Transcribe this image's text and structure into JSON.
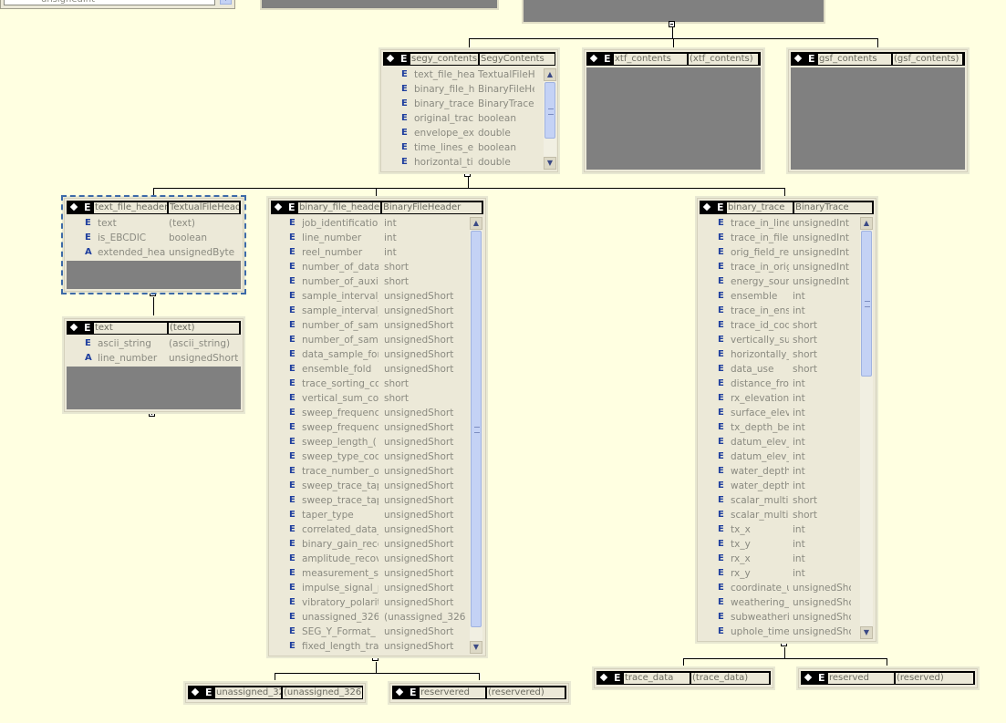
{
  "fragment_top_left": {
    "label": "unsignedInt"
  },
  "segy_contents": {
    "name": "segy_contents",
    "type": "SegyContents",
    "rows": [
      {
        "k": "E",
        "n": "text_file_hea",
        "t": "TextualFileH"
      },
      {
        "k": "E",
        "n": "binary_file_h",
        "t": "BinaryFileHe"
      },
      {
        "k": "E",
        "n": "binary_trace",
        "t": "BinaryTrace"
      },
      {
        "k": "E",
        "n": "original_trac",
        "t": "boolean"
      },
      {
        "k": "E",
        "n": "envelope_ex",
        "t": "double"
      },
      {
        "k": "E",
        "n": "time_lines_e",
        "t": "boolean"
      },
      {
        "k": "E",
        "n": "horizontal_ti",
        "t": "double"
      }
    ]
  },
  "xtf_contents": {
    "name": "xtf_contents",
    "type": "(xtf_contents)"
  },
  "gsf_contents": {
    "name": "gsf_contents",
    "type": "(gsf_contents)"
  },
  "text_file_header": {
    "name": "text_file_header",
    "type": "TextualFileHeader",
    "rows": [
      {
        "k": "E",
        "n": "text",
        "t": "(text)"
      },
      {
        "k": "E",
        "n": "is_EBCDIC",
        "t": "boolean"
      },
      {
        "k": "A",
        "n": "extended_hea",
        "t": "unsignedByte"
      }
    ]
  },
  "text": {
    "name": "text",
    "type": "(text)",
    "rows": [
      {
        "k": "E",
        "n": "ascii_string",
        "t": "(ascii_string)"
      },
      {
        "k": "A",
        "n": "line_number",
        "t": "unsignedShort"
      }
    ]
  },
  "binary_file_header": {
    "name": "binary_file_header",
    "type": "BinaryFileHeader",
    "rows": [
      {
        "k": "E",
        "n": "job_identification",
        "t": "int"
      },
      {
        "k": "E",
        "n": "line_number",
        "t": "int"
      },
      {
        "k": "E",
        "n": "reel_number",
        "t": "int"
      },
      {
        "k": "E",
        "n": "number_of_data",
        "t": "short"
      },
      {
        "k": "E",
        "n": "number_of_auxili",
        "t": "short"
      },
      {
        "k": "E",
        "n": "sample_interval_i",
        "t": "unsignedShort"
      },
      {
        "k": "E",
        "n": "sample_interval_i",
        "t": "unsignedShort"
      },
      {
        "k": "E",
        "n": "number_of_sam",
        "t": "unsignedShort"
      },
      {
        "k": "E",
        "n": "number_of_sam",
        "t": "unsignedShort"
      },
      {
        "k": "E",
        "n": "data_sample_for",
        "t": "unsignedShort"
      },
      {
        "k": "E",
        "n": "ensemble_fold",
        "t": "unsignedShort"
      },
      {
        "k": "E",
        "n": "trace_sorting_co",
        "t": "short"
      },
      {
        "k": "E",
        "n": "vertical_sum_cod",
        "t": "short"
      },
      {
        "k": "E",
        "n": "sweep_frequency",
        "t": "unsignedShort"
      },
      {
        "k": "E",
        "n": "sweep_frequency",
        "t": "unsignedShort"
      },
      {
        "k": "E",
        "n": "sweep_length_(",
        "t": "unsignedShort"
      },
      {
        "k": "E",
        "n": "sweep_type_cod",
        "t": "unsignedShort"
      },
      {
        "k": "E",
        "n": "trace_number_of",
        "t": "unsignedShort"
      },
      {
        "k": "E",
        "n": "sweep_trace_tap",
        "t": "unsignedShort"
      },
      {
        "k": "E",
        "n": "sweep_trace_tap",
        "t": "unsignedShort"
      },
      {
        "k": "E",
        "n": "taper_type",
        "t": "unsignedShort"
      },
      {
        "k": "E",
        "n": "correlated_data_",
        "t": "unsignedShort"
      },
      {
        "k": "E",
        "n": "binary_gain_reco",
        "t": "unsignedShort"
      },
      {
        "k": "E",
        "n": "amplitude_recov",
        "t": "unsignedShort"
      },
      {
        "k": "E",
        "n": "measurement_sy",
        "t": "unsignedShort"
      },
      {
        "k": "E",
        "n": "impulse_signal_p",
        "t": "unsignedShort"
      },
      {
        "k": "E",
        "n": "vibratory_polarit",
        "t": "unsignedShort"
      },
      {
        "k": "E",
        "n": "unassigned_3261",
        "t": "(unassigned_326"
      },
      {
        "k": "E",
        "n": "SEG_Y_Format_",
        "t": "unsignedShort"
      },
      {
        "k": "E",
        "n": "fixed_length_trac",
        "t": "unsignedShort"
      }
    ]
  },
  "binary_trace": {
    "name": "binary_trace",
    "type": "BinaryTrace",
    "rows": [
      {
        "k": "E",
        "n": "trace_in_line",
        "t": "unsignedInt"
      },
      {
        "k": "E",
        "n": "trace_in_file",
        "t": "unsignedInt"
      },
      {
        "k": "E",
        "n": "orig_field_re",
        "t": "unsignedInt"
      },
      {
        "k": "E",
        "n": "trace_in_orig",
        "t": "unsignedInt"
      },
      {
        "k": "E",
        "n": "energy_sour",
        "t": "unsignedInt"
      },
      {
        "k": "E",
        "n": "ensemble",
        "t": "int"
      },
      {
        "k": "E",
        "n": "trace_in_ens",
        "t": "int"
      },
      {
        "k": "E",
        "n": "trace_id_cod",
        "t": "short"
      },
      {
        "k": "E",
        "n": "vertically_su",
        "t": "short"
      },
      {
        "k": "E",
        "n": "horizontally_",
        "t": "short"
      },
      {
        "k": "E",
        "n": "data_use",
        "t": "short"
      },
      {
        "k": "E",
        "n": "distance_fro",
        "t": "int"
      },
      {
        "k": "E",
        "n": "rx_elevation",
        "t": "int"
      },
      {
        "k": "E",
        "n": "surface_elev",
        "t": "int"
      },
      {
        "k": "E",
        "n": "tx_depth_bel",
        "t": "int"
      },
      {
        "k": "E",
        "n": "datum_elev_",
        "t": "int"
      },
      {
        "k": "E",
        "n": "datum_elev_",
        "t": "int"
      },
      {
        "k": "E",
        "n": "water_depth",
        "t": "int"
      },
      {
        "k": "E",
        "n": "water_depth",
        "t": "int"
      },
      {
        "k": "E",
        "n": "scalar_multip",
        "t": "short"
      },
      {
        "k": "E",
        "n": "scalar_multip",
        "t": "short"
      },
      {
        "k": "E",
        "n": "tx_x",
        "t": "int"
      },
      {
        "k": "E",
        "n": "tx_y",
        "t": "int"
      },
      {
        "k": "E",
        "n": "rx_x",
        "t": "int"
      },
      {
        "k": "E",
        "n": "rx_y",
        "t": "int"
      },
      {
        "k": "E",
        "n": "coordinate_u",
        "t": "unsignedSho"
      },
      {
        "k": "E",
        "n": "weathering_",
        "t": "unsignedSho"
      },
      {
        "k": "E",
        "n": "subweatheri",
        "t": "unsignedSho"
      },
      {
        "k": "E",
        "n": "uphole_time",
        "t": "unsignedSho"
      }
    ]
  },
  "unassigned_3261": {
    "name": "unassigned_32",
    "type": "(unassigned_3261"
  },
  "reservered_1": {
    "name": "reservered",
    "type": "(reservered)"
  },
  "trace_data": {
    "name": "trace_data",
    "type": "(trace_data)"
  },
  "reserved_2": {
    "name": "reserved",
    "type": "(reserved)"
  }
}
